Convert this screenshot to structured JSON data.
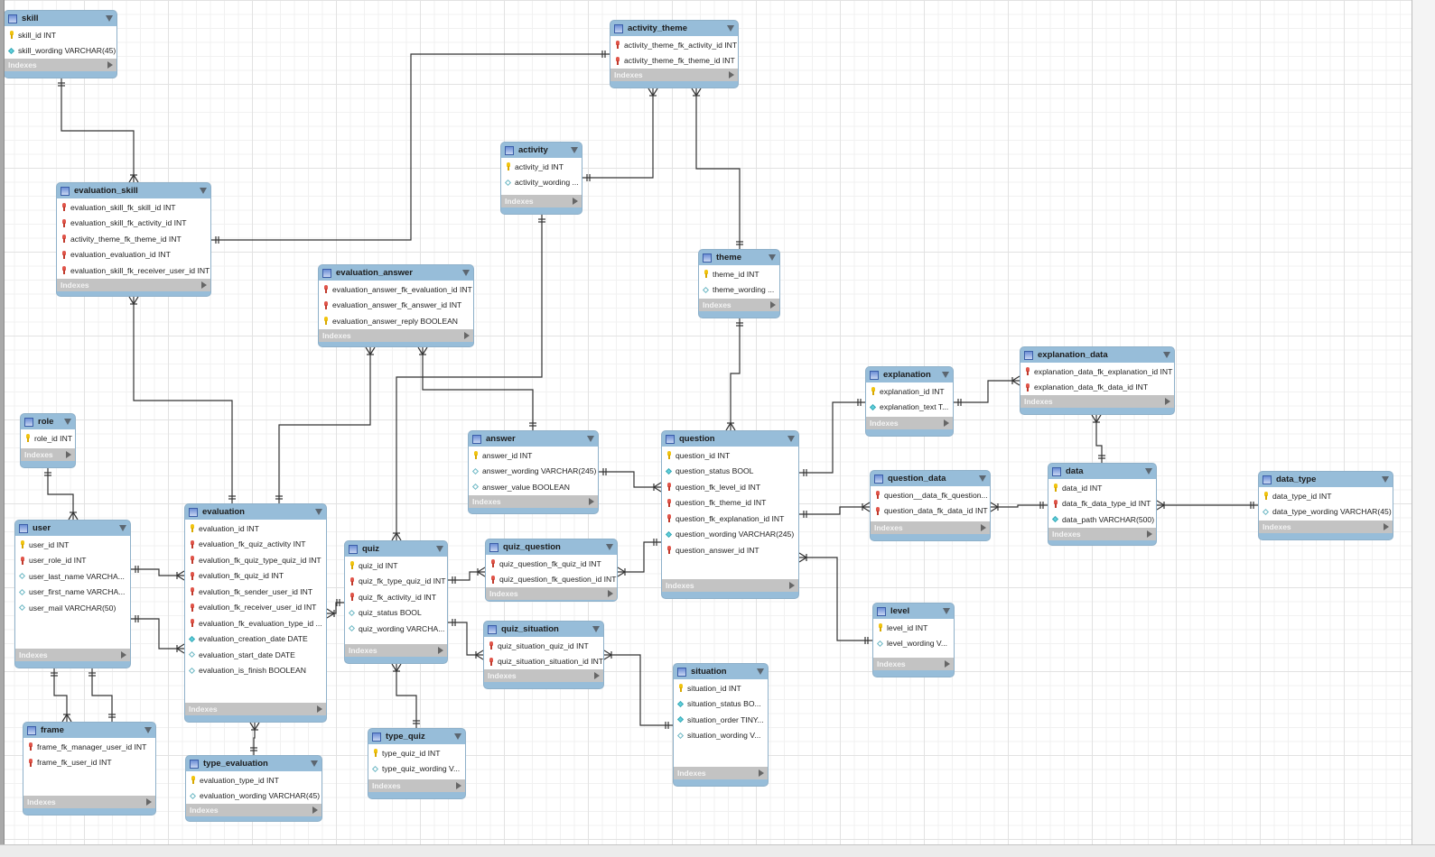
{
  "diagram": {
    "indexes_label": "Indexes",
    "colors": {
      "table_header": "#97bdd9",
      "indexes_bar": "#c3c3c3",
      "primary_key": "#f1c40f",
      "foreign_key": "#e0554a",
      "not_null": "#5fd0dc",
      "line": "#333333"
    },
    "tables": [
      {
        "name": "skill",
        "columns": [
          {
            "icon": "primary-key",
            "text": "skill_id INT"
          },
          {
            "icon": "column-not-null",
            "text": "skill_wording VARCHAR(45)"
          }
        ]
      },
      {
        "name": "activity_theme",
        "columns": [
          {
            "icon": "foreign-key",
            "text": "activity_theme_fk_activity_id INT"
          },
          {
            "icon": "foreign-key",
            "text": "activity_theme_fk_theme_id INT"
          }
        ]
      },
      {
        "name": "activity",
        "columns": [
          {
            "icon": "primary-key",
            "text": "activity_id INT"
          },
          {
            "icon": "column-nullable",
            "text": "activity_wording ..."
          }
        ]
      },
      {
        "name": "evaluation_skill",
        "columns": [
          {
            "icon": "foreign-key",
            "text": "evaluation_skill_fk_skill_id INT"
          },
          {
            "icon": "foreign-key",
            "text": "evaluation_skill_fk_activity_id INT"
          },
          {
            "icon": "foreign-key",
            "text": "activity_theme_fk_theme_id INT"
          },
          {
            "icon": "foreign-key",
            "text": "evaluation_evaluation_id INT"
          },
          {
            "icon": "foreign-key",
            "text": "evaluation_skill_fk_receiver_user_id INT"
          }
        ]
      },
      {
        "name": "evaluation_answer",
        "columns": [
          {
            "icon": "foreign-key",
            "text": "evaluation_answer_fk_evaluation_id INT"
          },
          {
            "icon": "foreign-key",
            "text": "evaluation_answer_fk_answer_id INT"
          },
          {
            "icon": "primary-key",
            "text": "evaluation_answer_reply BOOLEAN"
          }
        ]
      },
      {
        "name": "theme",
        "columns": [
          {
            "icon": "primary-key",
            "text": "theme_id INT"
          },
          {
            "icon": "column-nullable",
            "text": "theme_wording ..."
          }
        ]
      },
      {
        "name": "role",
        "columns": [
          {
            "icon": "primary-key",
            "text": "role_id INT"
          }
        ]
      },
      {
        "name": "answer",
        "columns": [
          {
            "icon": "primary-key",
            "text": "answer_id INT"
          },
          {
            "icon": "column-nullable",
            "text": "answer_wording VARCHAR(245)"
          },
          {
            "icon": "column-nullable",
            "text": "answer_value BOOLEAN"
          }
        ]
      },
      {
        "name": "question",
        "columns": [
          {
            "icon": "primary-key",
            "text": "question_id INT"
          },
          {
            "icon": "column-not-null",
            "text": "question_status BOOL"
          },
          {
            "icon": "foreign-key",
            "text": "question_fk_level_id INT"
          },
          {
            "icon": "foreign-key",
            "text": "question_fk_theme_id INT"
          },
          {
            "icon": "foreign-key",
            "text": "question_fk_explanation_id INT"
          },
          {
            "icon": "column-not-null",
            "text": "question_wording VARCHAR(245)"
          },
          {
            "icon": "foreign-key",
            "text": "question_answer_id INT"
          }
        ]
      },
      {
        "name": "explanation",
        "columns": [
          {
            "icon": "primary-key",
            "text": "explanation_id INT"
          },
          {
            "icon": "column-not-null",
            "text": "explanation_text T..."
          }
        ]
      },
      {
        "name": "explanation_data",
        "columns": [
          {
            "icon": "foreign-key",
            "text": "explanation_data_fk_explanation_id INT"
          },
          {
            "icon": "foreign-key",
            "text": "explanation_data_fk_data_id INT"
          }
        ]
      },
      {
        "name": "question_data",
        "columns": [
          {
            "icon": "foreign-key",
            "text": "question__data_fk_question..."
          },
          {
            "icon": "foreign-key",
            "text": "question_data_fk_data_id INT"
          }
        ]
      },
      {
        "name": "data",
        "columns": [
          {
            "icon": "primary-key",
            "text": "data_id INT"
          },
          {
            "icon": "foreign-key",
            "text": "data_fk_data_type_id INT"
          },
          {
            "icon": "column-not-null",
            "text": "data_path VARCHAR(500)"
          }
        ]
      },
      {
        "name": "data_type",
        "columns": [
          {
            "icon": "primary-key",
            "text": "data_type_id INT"
          },
          {
            "icon": "column-nullable",
            "text": "data_type_wording VARCHAR(45)"
          }
        ]
      },
      {
        "name": "user",
        "columns": [
          {
            "icon": "primary-key",
            "text": "user_id INT"
          },
          {
            "icon": "foreign-key",
            "text": "user_role_id INT"
          },
          {
            "icon": "column-nullable",
            "text": "user_last_name VARCHA..."
          },
          {
            "icon": "column-nullable",
            "text": "user_first_name VARCHA..."
          },
          {
            "icon": "column-nullable",
            "text": "user_mail VARCHAR(50)"
          }
        ]
      },
      {
        "name": "evaluation",
        "columns": [
          {
            "icon": "primary-key",
            "text": "evaluation_id INT"
          },
          {
            "icon": "foreign-key",
            "text": "evaluation_fk_quiz_activity INT"
          },
          {
            "icon": "foreign-key",
            "text": "evalution_fk_quiz_type_quiz_id INT"
          },
          {
            "icon": "foreign-key",
            "text": "evalution_fk_quiz_id INT"
          },
          {
            "icon": "foreign-key",
            "text": "evalution_fk_sender_user_id INT"
          },
          {
            "icon": "foreign-key",
            "text": "evalution_fk_receiver_user_id INT"
          },
          {
            "icon": "foreign-key",
            "text": "evaluation_fk_evaluation_type_id ..."
          },
          {
            "icon": "column-not-null",
            "text": "evaluation_creation_date DATE"
          },
          {
            "icon": "column-nullable",
            "text": "evaluation_start_date DATE"
          },
          {
            "icon": "column-nullable",
            "text": "evaluation_is_finish BOOLEAN"
          }
        ]
      },
      {
        "name": "quiz",
        "columns": [
          {
            "icon": "primary-key",
            "text": "quiz_id INT"
          },
          {
            "icon": "foreign-key",
            "text": "quiz_fk_type_quiz_id INT"
          },
          {
            "icon": "foreign-key",
            "text": "quiz_fk_activity_id INT"
          },
          {
            "icon": "column-nullable",
            "text": "quiz_status BOOL"
          },
          {
            "icon": "column-nullable",
            "text": "quiz_wording VARCHA..."
          }
        ]
      },
      {
        "name": "quiz_question",
        "columns": [
          {
            "icon": "foreign-key",
            "text": "quiz_question_fk_quiz_id INT"
          },
          {
            "icon": "foreign-key",
            "text": "quiz_question_fk_question_id INT"
          }
        ]
      },
      {
        "name": "quiz_situation",
        "columns": [
          {
            "icon": "foreign-key",
            "text": "quiz_situation_quiz_id INT"
          },
          {
            "icon": "foreign-key",
            "text": "quiz_situation_situation_id INT"
          }
        ]
      },
      {
        "name": "situation",
        "columns": [
          {
            "icon": "primary-key",
            "text": "situation_id INT"
          },
          {
            "icon": "column-not-null",
            "text": "situation_status BO..."
          },
          {
            "icon": "column-not-null",
            "text": "situation_order TINY..."
          },
          {
            "icon": "column-nullable",
            "text": "situation_wording V..."
          }
        ]
      },
      {
        "name": "level",
        "columns": [
          {
            "icon": "primary-key",
            "text": "level_id INT"
          },
          {
            "icon": "column-nullable",
            "text": "level_wording V..."
          }
        ]
      },
      {
        "name": "frame",
        "columns": [
          {
            "icon": "foreign-key",
            "text": "frame_fk_manager_user_id INT"
          },
          {
            "icon": "foreign-key",
            "text": "frame_fk_user_id INT"
          }
        ]
      },
      {
        "name": "type_evaluation",
        "columns": [
          {
            "icon": "primary-key",
            "text": "evaluation_type_id INT"
          },
          {
            "icon": "column-nullable",
            "text": "evaluation_wording VARCHAR(45)"
          }
        ]
      },
      {
        "name": "type_quiz",
        "columns": [
          {
            "icon": "primary-key",
            "text": "type_quiz_id INT"
          },
          {
            "icon": "column-nullable",
            "text": "type_quiz_wording V..."
          }
        ]
      }
    ],
    "relationships": [
      {
        "from": "skill",
        "to": "evaluation_skill",
        "type": "one-to-many"
      },
      {
        "from": "evaluation_skill",
        "to": "activity_theme",
        "type": "one-to-one"
      },
      {
        "from": "activity",
        "to": "activity_theme",
        "type": "one-to-many"
      },
      {
        "from": "theme",
        "to": "activity_theme",
        "type": "one-to-many"
      },
      {
        "from": "activity",
        "to": "quiz",
        "type": "one-to-many"
      },
      {
        "from": "evaluation",
        "to": "evaluation_skill",
        "type": "one-to-many"
      },
      {
        "from": "evaluation",
        "to": "evaluation_answer",
        "type": "one-to-many"
      },
      {
        "from": "answer",
        "to": "evaluation_answer",
        "type": "one-to-many"
      },
      {
        "from": "theme",
        "to": "question",
        "type": "one-to-many"
      },
      {
        "from": "role",
        "to": "user",
        "type": "one-to-many"
      },
      {
        "from": "user",
        "to": "evaluation",
        "type": "one-to-many"
      },
      {
        "from": "user",
        "to": "evaluation",
        "type": "one-to-many"
      },
      {
        "from": "user",
        "to": "frame",
        "type": "one-to-many"
      },
      {
        "from": "user",
        "to": "frame",
        "type": "one-to-one"
      },
      {
        "from": "type_evaluation",
        "to": "evaluation",
        "type": "one-to-many"
      },
      {
        "from": "quiz",
        "to": "evaluation",
        "type": "one-to-many"
      },
      {
        "from": "quiz",
        "to": "quiz_question",
        "type": "one-to-many"
      },
      {
        "from": "quiz",
        "to": "quiz_situation",
        "type": "one-to-many"
      },
      {
        "from": "type_quiz",
        "to": "quiz",
        "type": "one-to-many"
      },
      {
        "from": "answer",
        "to": "question",
        "type": "one-to-many"
      },
      {
        "from": "question",
        "to": "quiz_question",
        "type": "one-to-many"
      },
      {
        "from": "situation",
        "to": "quiz_situation",
        "type": "one-to-many"
      },
      {
        "from": "explanation",
        "to": "question",
        "type": "one-to-one"
      },
      {
        "from": "explanation",
        "to": "explanation_data",
        "type": "one-to-many"
      },
      {
        "from": "question",
        "to": "question_data",
        "type": "one-to-many"
      },
      {
        "from": "data",
        "to": "question_data",
        "type": "one-to-many"
      },
      {
        "from": "data",
        "to": "explanation_data",
        "type": "one-to-many"
      },
      {
        "from": "data_type",
        "to": "data",
        "type": "one-to-many"
      },
      {
        "from": "level",
        "to": "question",
        "type": "one-to-many"
      }
    ]
  }
}
